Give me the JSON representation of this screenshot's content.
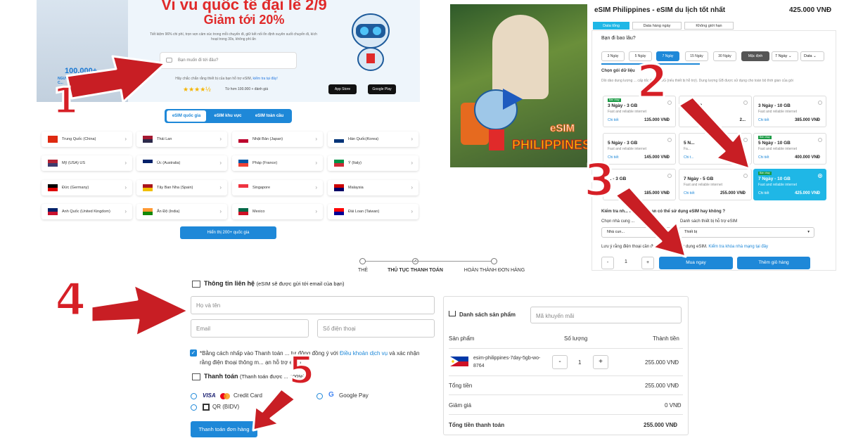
{
  "panel1": {
    "title": "Vi vu quốc tế đại lễ 2/9",
    "subtitle": "Giảm tới 20%",
    "desc": "Tiết kiệm 96% chi phí, trọn vẹn cảm xúc trong mỗi chuyến đi, giữ kết nối ổn định xuyên suốt chuyến đi, kích hoạt trong 30s, không phí ẩn",
    "search_placeholder": "Bạn muốn đi tới đâu?",
    "hint": "Hãy chắc chắn rằng thiết bị của bạn hỗ trợ eSIM,",
    "hint_link": "kiểm tra tại đây!",
    "stars": "★★★★½",
    "rating": "Từ hơn 100.000 + đánh giá",
    "people_count": "100.000+",
    "people_desc": "NGƯỜI NỔI TIẾNG & DU LỊCH C...",
    "appstore": "App Store",
    "googleplay": "Google Play"
  },
  "tabs": [
    "eSIM quốc gia",
    "eSIM khu vực",
    "eSIM toàn cầu"
  ],
  "countries": [
    {
      "name": "Trung Quốc (China)",
      "flag": "cn"
    },
    {
      "name": "Thái Lan",
      "flag": "th"
    },
    {
      "name": "Nhật Bản (Japan)",
      "flag": "jp"
    },
    {
      "name": "Hàn Quốc(Korea)",
      "flag": "kr"
    },
    {
      "name": "Mỹ (USA) US",
      "flag": "us"
    },
    {
      "name": "Úc (Australia)",
      "flag": "au"
    },
    {
      "name": "Pháp (France)",
      "flag": "fr"
    },
    {
      "name": "Ý (Italy)",
      "flag": "it"
    },
    {
      "name": "Đức (Germany)",
      "flag": "de"
    },
    {
      "name": "Tây Ban Nha (Spain)",
      "flag": "es"
    },
    {
      "name": "Singapore",
      "flag": "sg"
    },
    {
      "name": "Malaysia",
      "flag": "my"
    },
    {
      "name": "Anh Quốc (United Kingdom)",
      "flag": "gb"
    },
    {
      "name": "Ấn Độ (India)",
      "flag": "in"
    },
    {
      "name": "Mexico",
      "flag": "mx"
    },
    {
      "name": "Đài Loan (Taiwan)",
      "flag": "tw"
    }
  ],
  "more_button": "Hiển thị 200+ quốc gia",
  "product": {
    "image_text": "eSIM",
    "image_text2": "PHILIPPINES",
    "title": "eSIM Philippines - eSIM du lịch tốt nhất",
    "price": "425.000 VNĐ",
    "data_tabs": [
      "Data tổng",
      "Data hàng ngày",
      "Không giới hạn"
    ],
    "question": "Bạn đi bao lâu?",
    "days": [
      "3 Ngày",
      "5 Ngày",
      "7 Ngày",
      "15 Ngày",
      "30 Ngày",
      "Mặc định"
    ],
    "day_select": "7 Ngày",
    "data_select": "Data",
    "choose_label": "Chọn gói dữ liệu",
    "choose_desc": "Dồi dào dung lượng ... cấp tốc độ cao 5G (nếu thiết bị hỗ trợ). Dung lượng GB được sử dụng cho toàn bộ thời gian của gói",
    "cards": [
      {
        "name": "3 Ngày - 3 GB",
        "feature": "Fast and reliable internet",
        "detail": "Chi tiết",
        "price": "135.000 VNĐ",
        "badge": "Bán chạy"
      },
      {
        "name": "... - 5 GB",
        "feature": "",
        "detail": "",
        "price": "2...",
        "badge": ""
      },
      {
        "name": "3 Ngày - 10 GB",
        "feature": "Fast and reliable internet",
        "detail": "Chi tiết",
        "price": "385.000 VNĐ",
        "badge": ""
      },
      {
        "name": "5 Ngày - 3 GB",
        "feature": "Fast and reliable internet",
        "detail": "Chi tiết",
        "price": "145.000 VNĐ",
        "badge": ""
      },
      {
        "name": "5 N...",
        "feature": "Fa...",
        "detail": "Chi t...",
        "price": "",
        "badge": ""
      },
      {
        "name": "5 Ngày - 10 GB",
        "feature": "Fast and reliable internet",
        "detail": "Chi tiết",
        "price": "400.000 VNĐ",
        "badge": "Bán chạy"
      },
      {
        "name": "... - 3 GB",
        "feature": "",
        "detail": "",
        "price": "185.000 VNĐ",
        "badge": ""
      },
      {
        "name": "7 Ngày - 5 GB",
        "feature": "Fast and reliable internet",
        "detail": "Chi tiết",
        "price": "255.000 VNĐ",
        "badge": ""
      },
      {
        "name": "7 Ngày - 10 GB",
        "feature": "Fast and reliable internet",
        "detail": "Chi tiết",
        "price": "425.000 VNĐ",
        "badge": "Bán chạy"
      }
    ],
    "check_q": "Kiểm tra nh... thoại của bạn có thể sử dụng eSIM hay không ?",
    "provider_label": "Chọn nhà cung ...",
    "provider_value": "Nhà cun...",
    "device_label": "Danh sách thiết bị hỗ trợ eSIM",
    "device_value": "Thiết bị",
    "note": "Lưu ý rằng điện thoại cần được mở ... để sử dụng eSIM.",
    "note_link": "Kiểm tra khóa nhà mạng tại đây",
    "qty": "1",
    "minus": "-",
    "plus": "+",
    "buy": "Mua ngay",
    "cart": "Thêm giỏ hàng"
  },
  "steps": [
    "THẺ",
    "THỦ TỤC THANH TOÁN",
    "HOÀN THÀNH ĐƠN HÀNG"
  ],
  "checkout": {
    "contact_title": "Thông tin liên hệ",
    "contact_note": "(eSIM sẽ được gửi tới email của bạn)",
    "name_ph": "Họ và tên",
    "email_ph": "Email",
    "phone_ph": "Số điện thoại",
    "terms1": "*Bằng cách nhấp vào Thanh toán ... tự động đồng ý với",
    "terms_link": "Điều khoản dịch vụ",
    "terms2": "và xác nhận rằng điện thoại thông m... ạn hỗ trợ esim.",
    "pay_title": "Thanh toán",
    "pay_note": "(Thanh toán được ... 100%)",
    "visa": "VISA",
    "credit": "Credit Card",
    "gpay": "Google Pay",
    "qr": "QR (BIDV)",
    "pay_button": "Thanh toán đơn hàng"
  },
  "summary": {
    "title": "Danh sách sản phẩm",
    "coupon_ph": "Mã khuyến mãi",
    "col_product": "Sản phẩm",
    "col_qty": "Số lượng",
    "col_total": "Thành tiền",
    "item_name": "esim-philippines-7day-5gb-wo-8764",
    "item_qty": "1",
    "item_total": "255.000 VNĐ",
    "subtotal_label": "Tổng tiền",
    "subtotal": "255.000 VNĐ",
    "discount_label": "Giảm giá",
    "discount": "0 VNĐ",
    "grand_label": "Tổng tiền thanh toán",
    "grand": "255.000 VNĐ"
  },
  "step_numbers": [
    "1",
    "2",
    "3",
    "4",
    "5"
  ],
  "colors": {
    "accent": "#1e88d8",
    "cyan": "#1fb7e6",
    "arrow": "#d61f26"
  }
}
